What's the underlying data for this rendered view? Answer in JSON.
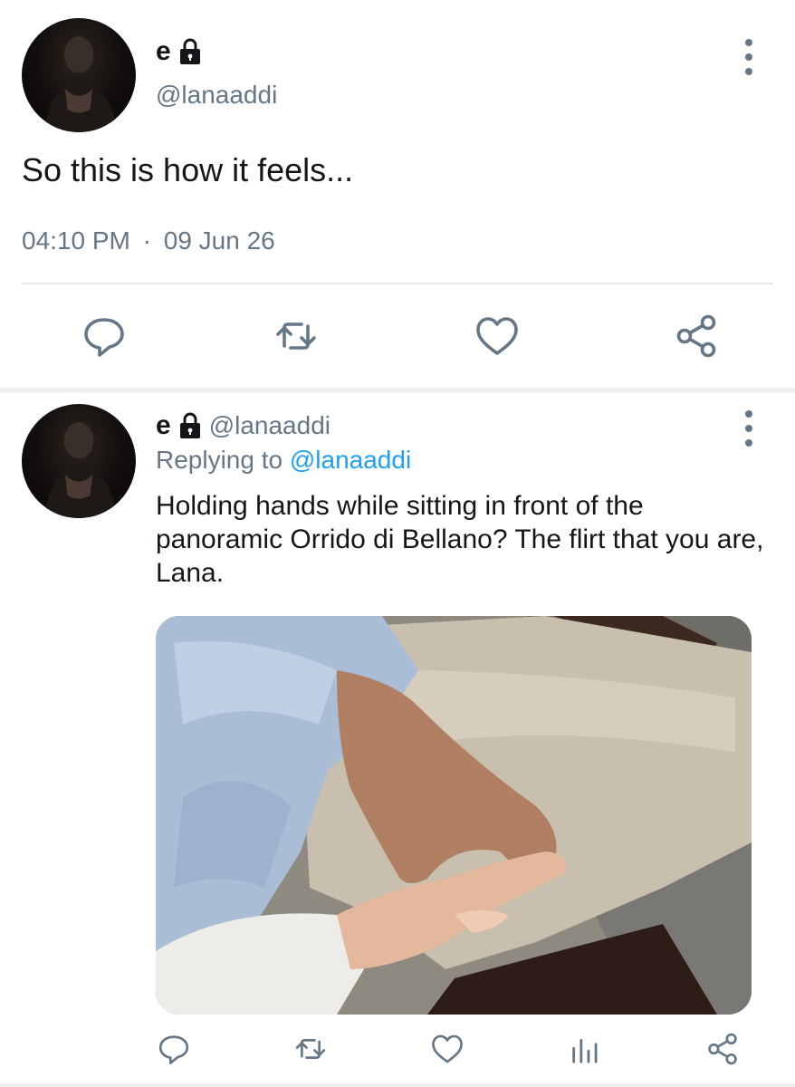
{
  "main_tweet": {
    "display_name": "e",
    "handle": "@lanaaddi",
    "text": "So this is how it feels...",
    "time": "04:10 PM",
    "separator": "·",
    "date": "09 Jun 26",
    "icons": [
      "lock-icon",
      "more-icon",
      "reply-icon",
      "retweet-icon",
      "like-icon",
      "share-icon"
    ]
  },
  "reply_tweet": {
    "display_name": "e",
    "handle": "@lanaaddi",
    "replying_prefix": "Replying to",
    "replying_handle": "@lanaaddi",
    "text": "Holding hands while sitting in front of the panoramic Orrido di Bellano? The flirt that you are, Lana.",
    "icons": [
      "lock-icon",
      "more-icon",
      "reply-icon",
      "retweet-icon",
      "like-icon",
      "analytics-icon",
      "share-icon"
    ]
  },
  "colors": {
    "text": "#14171a",
    "secondary": "#657786",
    "link": "#1da1f2",
    "divider": "#e1e8ed"
  }
}
